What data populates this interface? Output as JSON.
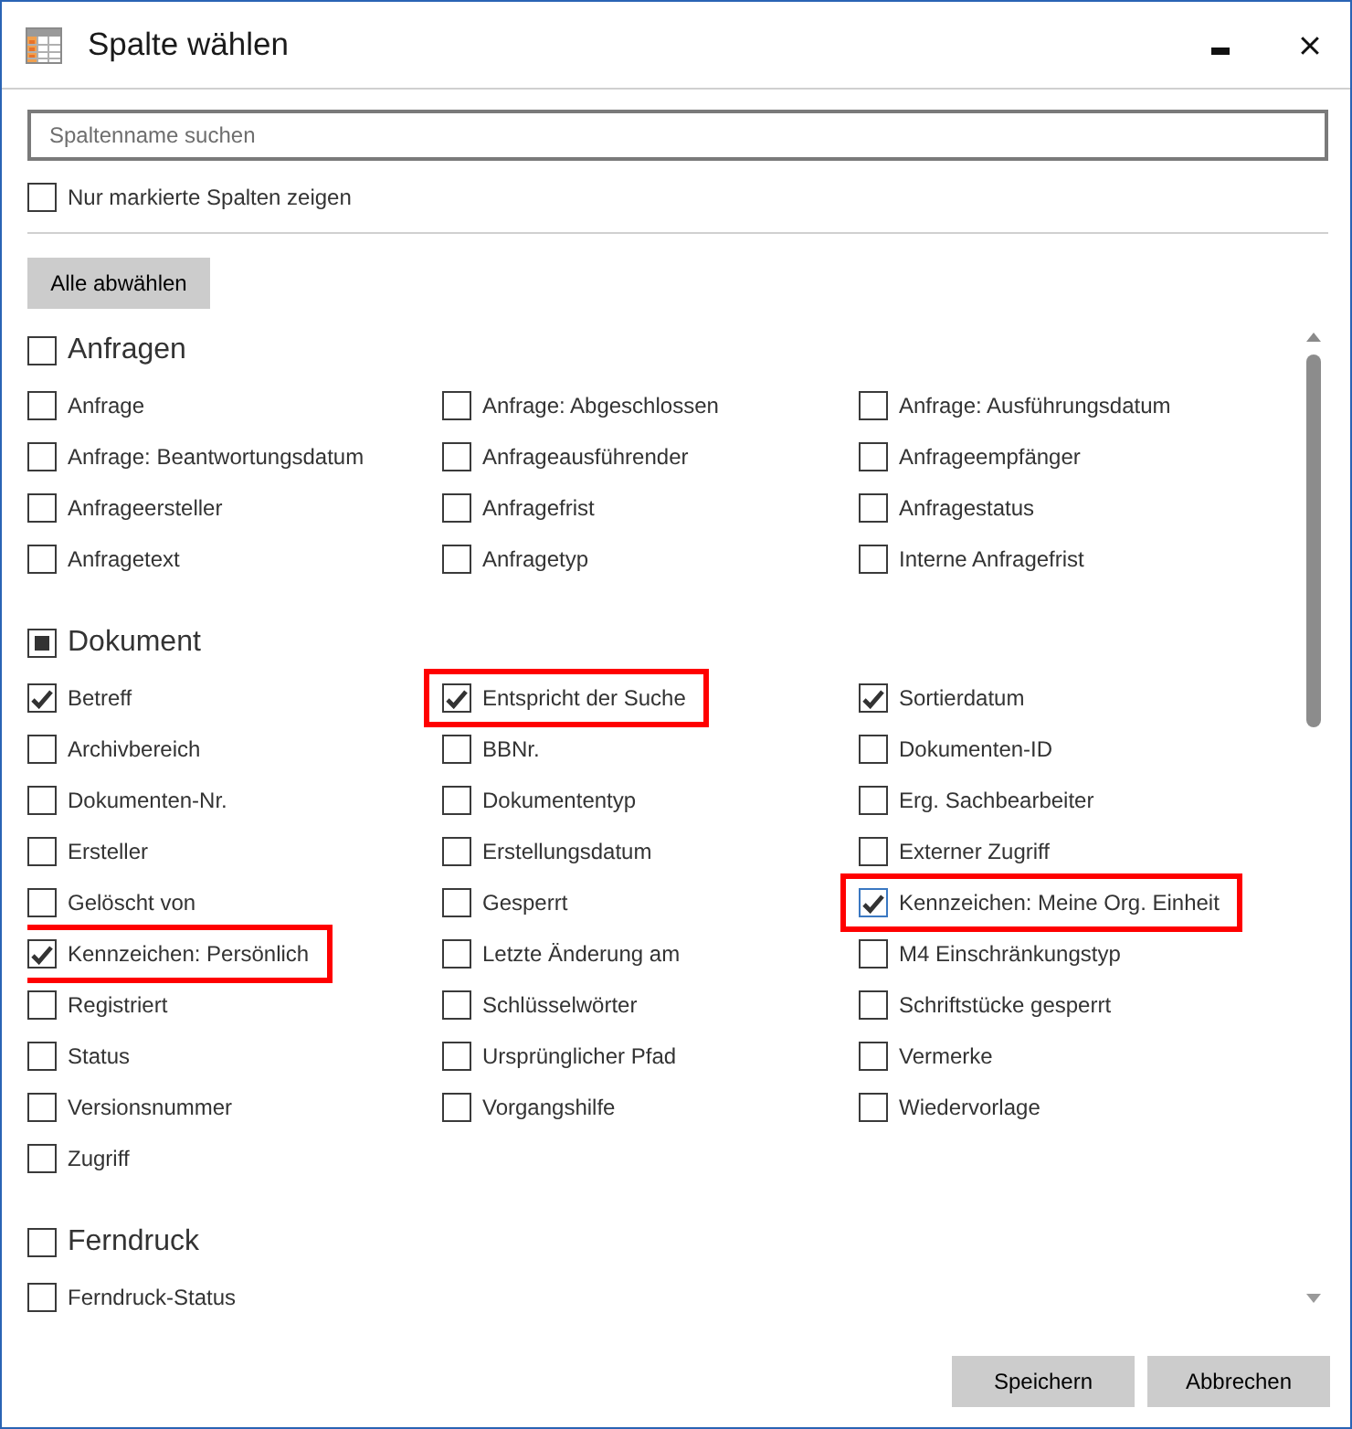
{
  "window": {
    "title": "Spalte wählen"
  },
  "search": {
    "placeholder": "Spaltenname suchen"
  },
  "filter": {
    "label": "Nur markierte Spalten zeigen",
    "checked": false
  },
  "deselect_button": "Alle abwählen",
  "groups": [
    {
      "name": "Anfragen",
      "checked": false,
      "indeterminate": false,
      "items": [
        {
          "label": "Anfrage",
          "checked": false,
          "highlighted": false,
          "focused": false
        },
        {
          "label": "Anfrage: Abgeschlossen",
          "checked": false,
          "highlighted": false,
          "focused": false
        },
        {
          "label": "Anfrage: Ausführungsdatum",
          "checked": false,
          "highlighted": false,
          "focused": false
        },
        {
          "label": "Anfrage: Beantwortungsdatum",
          "checked": false,
          "highlighted": false,
          "focused": false
        },
        {
          "label": "Anfrageausführender",
          "checked": false,
          "highlighted": false,
          "focused": false
        },
        {
          "label": "Anfrageempfänger",
          "checked": false,
          "highlighted": false,
          "focused": false
        },
        {
          "label": "Anfrageersteller",
          "checked": false,
          "highlighted": false,
          "focused": false
        },
        {
          "label": "Anfragefrist",
          "checked": false,
          "highlighted": false,
          "focused": false
        },
        {
          "label": "Anfragestatus",
          "checked": false,
          "highlighted": false,
          "focused": false
        },
        {
          "label": "Anfragetext",
          "checked": false,
          "highlighted": false,
          "focused": false
        },
        {
          "label": "Anfragetyp",
          "checked": false,
          "highlighted": false,
          "focused": false
        },
        {
          "label": "Interne Anfragefrist",
          "checked": false,
          "highlighted": false,
          "focused": false
        }
      ]
    },
    {
      "name": "Dokument",
      "checked": false,
      "indeterminate": true,
      "items": [
        {
          "label": "Betreff",
          "checked": true,
          "highlighted": false,
          "focused": false
        },
        {
          "label": "Entspricht der Suche",
          "checked": true,
          "highlighted": true,
          "focused": false
        },
        {
          "label": "Sortierdatum",
          "checked": true,
          "highlighted": false,
          "focused": false
        },
        {
          "label": "Archivbereich",
          "checked": false,
          "highlighted": false,
          "focused": false
        },
        {
          "label": "BBNr.",
          "checked": false,
          "highlighted": false,
          "focused": false
        },
        {
          "label": "Dokumenten-ID",
          "checked": false,
          "highlighted": false,
          "focused": false
        },
        {
          "label": "Dokumenten-Nr.",
          "checked": false,
          "highlighted": false,
          "focused": false
        },
        {
          "label": "Dokumententyp",
          "checked": false,
          "highlighted": false,
          "focused": false
        },
        {
          "label": "Erg. Sachbearbeiter",
          "checked": false,
          "highlighted": false,
          "focused": false
        },
        {
          "label": "Ersteller",
          "checked": false,
          "highlighted": false,
          "focused": false
        },
        {
          "label": "Erstellungsdatum",
          "checked": false,
          "highlighted": false,
          "focused": false
        },
        {
          "label": "Externer Zugriff",
          "checked": false,
          "highlighted": false,
          "focused": false
        },
        {
          "label": "Gelöscht von",
          "checked": false,
          "highlighted": false,
          "focused": false
        },
        {
          "label": "Gesperrt",
          "checked": false,
          "highlighted": false,
          "focused": false
        },
        {
          "label": "Kennzeichen: Meine Org. Einheit",
          "checked": true,
          "highlighted": true,
          "focused": true
        },
        {
          "label": "Kennzeichen: Persönlich",
          "checked": true,
          "highlighted": true,
          "focused": false
        },
        {
          "label": "Letzte Änderung am",
          "checked": false,
          "highlighted": false,
          "focused": false
        },
        {
          "label": "M4 Einschränkungstyp",
          "checked": false,
          "highlighted": false,
          "focused": false
        },
        {
          "label": "Registriert",
          "checked": false,
          "highlighted": false,
          "focused": false
        },
        {
          "label": "Schlüsselwörter",
          "checked": false,
          "highlighted": false,
          "focused": false
        },
        {
          "label": "Schriftstücke gesperrt",
          "checked": false,
          "highlighted": false,
          "focused": false
        },
        {
          "label": "Status",
          "checked": false,
          "highlighted": false,
          "focused": false
        },
        {
          "label": "Ursprünglicher Pfad",
          "checked": false,
          "highlighted": false,
          "focused": false
        },
        {
          "label": "Vermerke",
          "checked": false,
          "highlighted": false,
          "focused": false
        },
        {
          "label": "Versionsnummer",
          "checked": false,
          "highlighted": false,
          "focused": false
        },
        {
          "label": "Vorgangshilfe",
          "checked": false,
          "highlighted": false,
          "focused": false
        },
        {
          "label": "Wiedervorlage",
          "checked": false,
          "highlighted": false,
          "focused": false
        },
        {
          "label": "Zugriff",
          "checked": false,
          "highlighted": false,
          "focused": false
        }
      ]
    },
    {
      "name": "Ferndruck",
      "checked": false,
      "indeterminate": false,
      "items": [
        {
          "label": "Ferndruck-Status",
          "checked": false,
          "highlighted": false,
          "focused": false
        }
      ]
    }
  ],
  "buttons": [
    "Speichern",
    "Abbrechen"
  ]
}
